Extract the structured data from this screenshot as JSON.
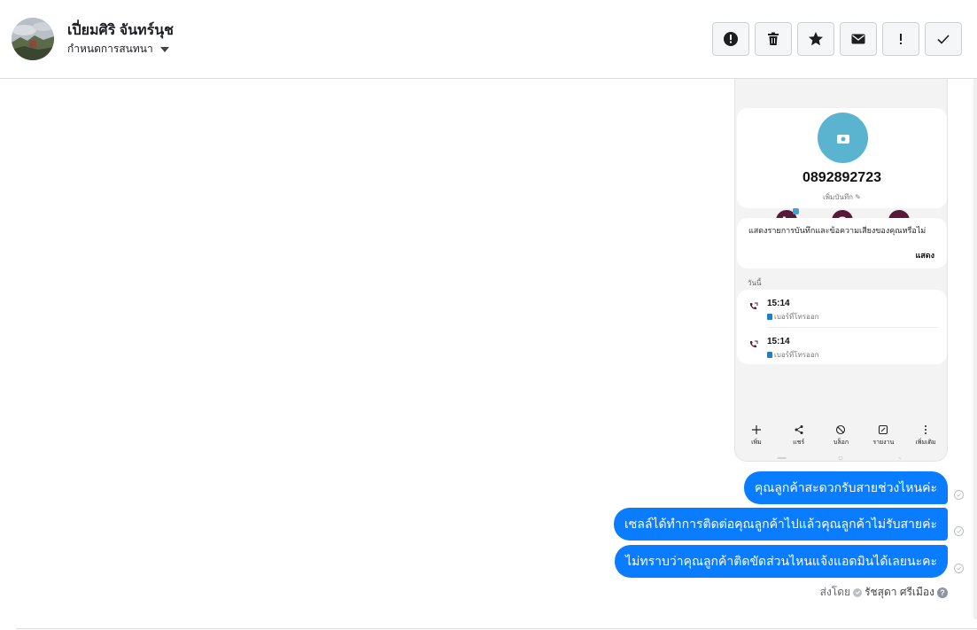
{
  "header": {
    "contact_name": "เปี่ยมศิริ จันทร์นุช",
    "assign_label": "กำหนดการสนทนา",
    "toolbar": [
      {
        "name": "mark-spam-button",
        "icon": "alert-circle-icon"
      },
      {
        "name": "delete-button",
        "icon": "trash-icon"
      },
      {
        "name": "star-button",
        "icon": "star-icon"
      },
      {
        "name": "mark-unread-button",
        "icon": "envelope-icon"
      },
      {
        "name": "follow-up-button",
        "icon": "exclamation-icon"
      },
      {
        "name": "mark-done-button",
        "icon": "checkmark-icon"
      }
    ]
  },
  "attachment": {
    "phone_number": "0892892723",
    "add_note": "เพิ่มบันทึก",
    "voicemail_question": "แสดงรายการบันทึกและข้อความเสียงของคุณหรือไม่",
    "show_button": "แสดง",
    "section_today": "วันนี้",
    "calls": [
      {
        "time": "15:14",
        "label": "เบอร์ที่โทรออก"
      },
      {
        "time": "15:14",
        "label": "เบอร์ที่โทรออก"
      }
    ],
    "bottom_actions": [
      {
        "label": "เพิ่ม",
        "icon": "plus-icon"
      },
      {
        "label": "แชร์",
        "icon": "share-icon"
      },
      {
        "label": "บล็อก",
        "icon": "block-icon"
      },
      {
        "label": "รายงาน",
        "icon": "report-icon"
      },
      {
        "label": "เพิ่มเติม",
        "icon": "more-icon"
      }
    ]
  },
  "messages": [
    {
      "text": "คุณลูกค้าสะดวกรับสายช่วงไหนค่ะ"
    },
    {
      "text": "เซลล์ได้ทำการติดต่อคุณลูกค้าไปแล้วคุณลูกค้าไม่รับสายค่ะ"
    },
    {
      "text": "ไม่ทราบว่าคุณลูกค้าติดขัดส่วนไหนแจ้งแอดมินได้เลยนะคะ"
    }
  ],
  "sent_by": {
    "prefix": "ส่งโดย",
    "agent": "รัชสุดา ศรีเมือง",
    "help": "?"
  },
  "colors": {
    "bubble": "#0a7cff",
    "phone_avatar": "#5ab4cf",
    "phone_action": "#5a1838"
  }
}
